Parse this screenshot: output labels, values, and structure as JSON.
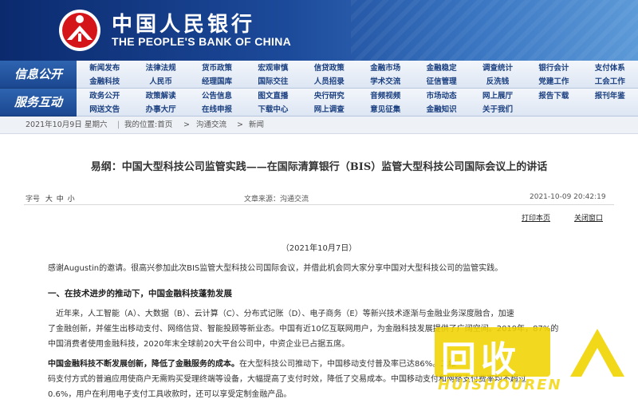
{
  "header": {
    "cn_title": "中国人民银行",
    "en_title": "THE PEOPLE'S BANK OF CHINA"
  },
  "nav": {
    "row1_label": "信息公开",
    "row2_label": "服务互动",
    "row1_top": [
      "新闻发布",
      "法律法规",
      "货币政策",
      "宏观审慎",
      "信贷政策",
      "金融市场",
      "金融稳定",
      "调查统计",
      "银行会计",
      "支付体系"
    ],
    "row1_bottom": [
      "金融科技",
      "人民币",
      "经理国库",
      "国际交往",
      "人员招录",
      "学术交流",
      "征信管理",
      "反洗钱",
      "党建工作",
      "工会工作"
    ],
    "row2_top": [
      "政务公开",
      "政策解读",
      "公告信息",
      "图文直播",
      "央行研究",
      "音频视频",
      "市场动态",
      "网上展厅",
      "报告下载",
      "报刊年鉴"
    ],
    "row2_bottom": [
      "网送文告",
      "办事大厅",
      "在线申报",
      "下载中心",
      "网上调查",
      "意见征集",
      "金融知识",
      "关于我们"
    ]
  },
  "breadcrumb": {
    "date": "2021年10月9日",
    "weekday": "星期六",
    "location_label": "我的位置:首页",
    "sep1": ">",
    "crumb2": "沟通交流",
    "sep2": ">",
    "crumb3": "新闻"
  },
  "article": {
    "title": "易纲：中国大型科技公司监管实践——在国际清算银行（BIS）监管大型科技公司国际会议上的讲话",
    "font_size_label": "字号",
    "size_large": "大",
    "size_medium": "中",
    "size_small": "小",
    "source": "文章来源：沟通交流",
    "datetime": "2021-10-09  20:42:19",
    "print_link": "打印本页",
    "close_link": "关闭窗口",
    "date_line": "（2021年10月7日）",
    "p1": "感谢Augustin的邀请。很高兴参加此次BIS监管大型科技公司国际会议，并借此机会同大家分享中国对大型科技公司的监管实践。",
    "h1": "一、在技术进步的推动下，中国金融科技蓬勃发展",
    "p2_l1": "近年来，人工智能（A）、大数据（B）、云计算（C）、分布式记账（D）、电子商务（E）等新兴技术逐渐与金融业务深度融合，加速",
    "p2_l2": "了金融创新，并催生出移动支付、网络信贷、智能投顾等新业态。中国有近10亿互联网用户，为金融科技发展提供了广阔空间。2019年，87%的",
    "p2_l3": "中国消费者使用金融科技，2020年末全球前20大平台公司中，中资企业已占据五席。",
    "p3_bold": "中国金融科技不断发展创新，降低了金融服务的成本。",
    "p3_l1": "在大型科技公司推动下，中国移动支付普及率已达86%。二维",
    "p3_l2": "码支付方式的普遍应用使商户无需购买受理终端等设备，大幅提高了支付时效，降低了交易成本。中国移动支付和网络支付费率均不超过",
    "p3_l3": "0.6%，用户在利用电子支付工具收款时，还可以享受定制金融产品。"
  },
  "watermark": {
    "text": "回收",
    "sub": "HUISHOUREN"
  },
  "colors": {
    "banner_dark": "#0b2a6e",
    "banner_light": "#5d9ad8",
    "nav_label_bg": "#1b4790",
    "nav_text": "#1a3f80",
    "emblem_red": "#d4161b"
  }
}
